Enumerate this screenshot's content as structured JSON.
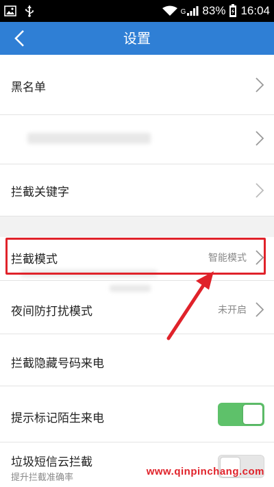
{
  "status_bar": {
    "battery_percent": "83%",
    "time": "16:04",
    "network_type": "G",
    "icons": [
      "image-icon",
      "usb-icon",
      "wifi-icon",
      "signal-icon",
      "battery-icon"
    ]
  },
  "app_bar": {
    "title": "设置",
    "back_icon": "chevron-left-icon"
  },
  "settings": {
    "blacklist": {
      "label": "黑名单"
    },
    "blurred_item": {
      "label": ""
    },
    "block_keywords": {
      "label": "拦截关键字"
    },
    "block_mode": {
      "label": "拦截模式",
      "value": "智能模式"
    },
    "night_mode": {
      "label": "夜间防打扰模式",
      "value": "未开启"
    },
    "block_hidden_numbers": {
      "label": "拦截隐藏号码来电"
    },
    "mark_strange_calls": {
      "label": "提示标记陌生来电",
      "toggle_on": true
    },
    "spam_sms_cloud": {
      "label": "垃圾短信云拦截",
      "sublabel": "提升拦截准确率",
      "toggle_on": false
    }
  },
  "annotation": {
    "highlight_color": "#e0222a"
  },
  "watermark": "www.qinpinchang.com",
  "colors": {
    "app_bar": "#2f7fd5",
    "toggle_on": "#5ec16a",
    "annotation": "#e0222a"
  }
}
